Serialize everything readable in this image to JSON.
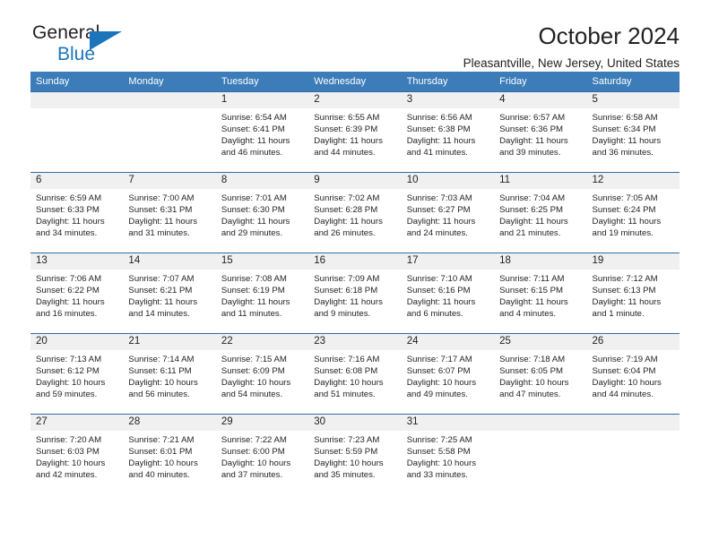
{
  "brand": {
    "name_top": "General",
    "name_bottom": "Blue",
    "accent_color": "#1b75bb"
  },
  "header": {
    "title": "October 2024",
    "subtitle": "Pleasantville, New Jersey, United States"
  },
  "calendar": {
    "header_color": "#3c7cb8",
    "daynum_bg": "#f0f0f0",
    "weekday_headers": [
      "Sunday",
      "Monday",
      "Tuesday",
      "Wednesday",
      "Thursday",
      "Friday",
      "Saturday"
    ],
    "labels": {
      "sunrise": "Sunrise:",
      "sunset": "Sunset:",
      "daylight": "Daylight:"
    },
    "weeks": [
      [
        {
          "day": "",
          "empty": true
        },
        {
          "day": "",
          "empty": true
        },
        {
          "day": "1",
          "sunrise": "Sunrise: 6:54 AM",
          "sunset": "Sunset: 6:41 PM",
          "daylight": "Daylight: 11 hours and 46 minutes."
        },
        {
          "day": "2",
          "sunrise": "Sunrise: 6:55 AM",
          "sunset": "Sunset: 6:39 PM",
          "daylight": "Daylight: 11 hours and 44 minutes."
        },
        {
          "day": "3",
          "sunrise": "Sunrise: 6:56 AM",
          "sunset": "Sunset: 6:38 PM",
          "daylight": "Daylight: 11 hours and 41 minutes."
        },
        {
          "day": "4",
          "sunrise": "Sunrise: 6:57 AM",
          "sunset": "Sunset: 6:36 PM",
          "daylight": "Daylight: 11 hours and 39 minutes."
        },
        {
          "day": "5",
          "sunrise": "Sunrise: 6:58 AM",
          "sunset": "Sunset: 6:34 PM",
          "daylight": "Daylight: 11 hours and 36 minutes."
        }
      ],
      [
        {
          "day": "6",
          "sunrise": "Sunrise: 6:59 AM",
          "sunset": "Sunset: 6:33 PM",
          "daylight": "Daylight: 11 hours and 34 minutes."
        },
        {
          "day": "7",
          "sunrise": "Sunrise: 7:00 AM",
          "sunset": "Sunset: 6:31 PM",
          "daylight": "Daylight: 11 hours and 31 minutes."
        },
        {
          "day": "8",
          "sunrise": "Sunrise: 7:01 AM",
          "sunset": "Sunset: 6:30 PM",
          "daylight": "Daylight: 11 hours and 29 minutes."
        },
        {
          "day": "9",
          "sunrise": "Sunrise: 7:02 AM",
          "sunset": "Sunset: 6:28 PM",
          "daylight": "Daylight: 11 hours and 26 minutes."
        },
        {
          "day": "10",
          "sunrise": "Sunrise: 7:03 AM",
          "sunset": "Sunset: 6:27 PM",
          "daylight": "Daylight: 11 hours and 24 minutes."
        },
        {
          "day": "11",
          "sunrise": "Sunrise: 7:04 AM",
          "sunset": "Sunset: 6:25 PM",
          "daylight": "Daylight: 11 hours and 21 minutes."
        },
        {
          "day": "12",
          "sunrise": "Sunrise: 7:05 AM",
          "sunset": "Sunset: 6:24 PM",
          "daylight": "Daylight: 11 hours and 19 minutes."
        }
      ],
      [
        {
          "day": "13",
          "sunrise": "Sunrise: 7:06 AM",
          "sunset": "Sunset: 6:22 PM",
          "daylight": "Daylight: 11 hours and 16 minutes."
        },
        {
          "day": "14",
          "sunrise": "Sunrise: 7:07 AM",
          "sunset": "Sunset: 6:21 PM",
          "daylight": "Daylight: 11 hours and 14 minutes."
        },
        {
          "day": "15",
          "sunrise": "Sunrise: 7:08 AM",
          "sunset": "Sunset: 6:19 PM",
          "daylight": "Daylight: 11 hours and 11 minutes."
        },
        {
          "day": "16",
          "sunrise": "Sunrise: 7:09 AM",
          "sunset": "Sunset: 6:18 PM",
          "daylight": "Daylight: 11 hours and 9 minutes."
        },
        {
          "day": "17",
          "sunrise": "Sunrise: 7:10 AM",
          "sunset": "Sunset: 6:16 PM",
          "daylight": "Daylight: 11 hours and 6 minutes."
        },
        {
          "day": "18",
          "sunrise": "Sunrise: 7:11 AM",
          "sunset": "Sunset: 6:15 PM",
          "daylight": "Daylight: 11 hours and 4 minutes."
        },
        {
          "day": "19",
          "sunrise": "Sunrise: 7:12 AM",
          "sunset": "Sunset: 6:13 PM",
          "daylight": "Daylight: 11 hours and 1 minute."
        }
      ],
      [
        {
          "day": "20",
          "sunrise": "Sunrise: 7:13 AM",
          "sunset": "Sunset: 6:12 PM",
          "daylight": "Daylight: 10 hours and 59 minutes."
        },
        {
          "day": "21",
          "sunrise": "Sunrise: 7:14 AM",
          "sunset": "Sunset: 6:11 PM",
          "daylight": "Daylight: 10 hours and 56 minutes."
        },
        {
          "day": "22",
          "sunrise": "Sunrise: 7:15 AM",
          "sunset": "Sunset: 6:09 PM",
          "daylight": "Daylight: 10 hours and 54 minutes."
        },
        {
          "day": "23",
          "sunrise": "Sunrise: 7:16 AM",
          "sunset": "Sunset: 6:08 PM",
          "daylight": "Daylight: 10 hours and 51 minutes."
        },
        {
          "day": "24",
          "sunrise": "Sunrise: 7:17 AM",
          "sunset": "Sunset: 6:07 PM",
          "daylight": "Daylight: 10 hours and 49 minutes."
        },
        {
          "day": "25",
          "sunrise": "Sunrise: 7:18 AM",
          "sunset": "Sunset: 6:05 PM",
          "daylight": "Daylight: 10 hours and 47 minutes."
        },
        {
          "day": "26",
          "sunrise": "Sunrise: 7:19 AM",
          "sunset": "Sunset: 6:04 PM",
          "daylight": "Daylight: 10 hours and 44 minutes."
        }
      ],
      [
        {
          "day": "27",
          "sunrise": "Sunrise: 7:20 AM",
          "sunset": "Sunset: 6:03 PM",
          "daylight": "Daylight: 10 hours and 42 minutes."
        },
        {
          "day": "28",
          "sunrise": "Sunrise: 7:21 AM",
          "sunset": "Sunset: 6:01 PM",
          "daylight": "Daylight: 10 hours and 40 minutes."
        },
        {
          "day": "29",
          "sunrise": "Sunrise: 7:22 AM",
          "sunset": "Sunset: 6:00 PM",
          "daylight": "Daylight: 10 hours and 37 minutes."
        },
        {
          "day": "30",
          "sunrise": "Sunrise: 7:23 AM",
          "sunset": "Sunset: 5:59 PM",
          "daylight": "Daylight: 10 hours and 35 minutes."
        },
        {
          "day": "31",
          "sunrise": "Sunrise: 7:25 AM",
          "sunset": "Sunset: 5:58 PM",
          "daylight": "Daylight: 10 hours and 33 minutes."
        },
        {
          "day": "",
          "empty": true
        },
        {
          "day": "",
          "empty": true
        }
      ]
    ]
  }
}
